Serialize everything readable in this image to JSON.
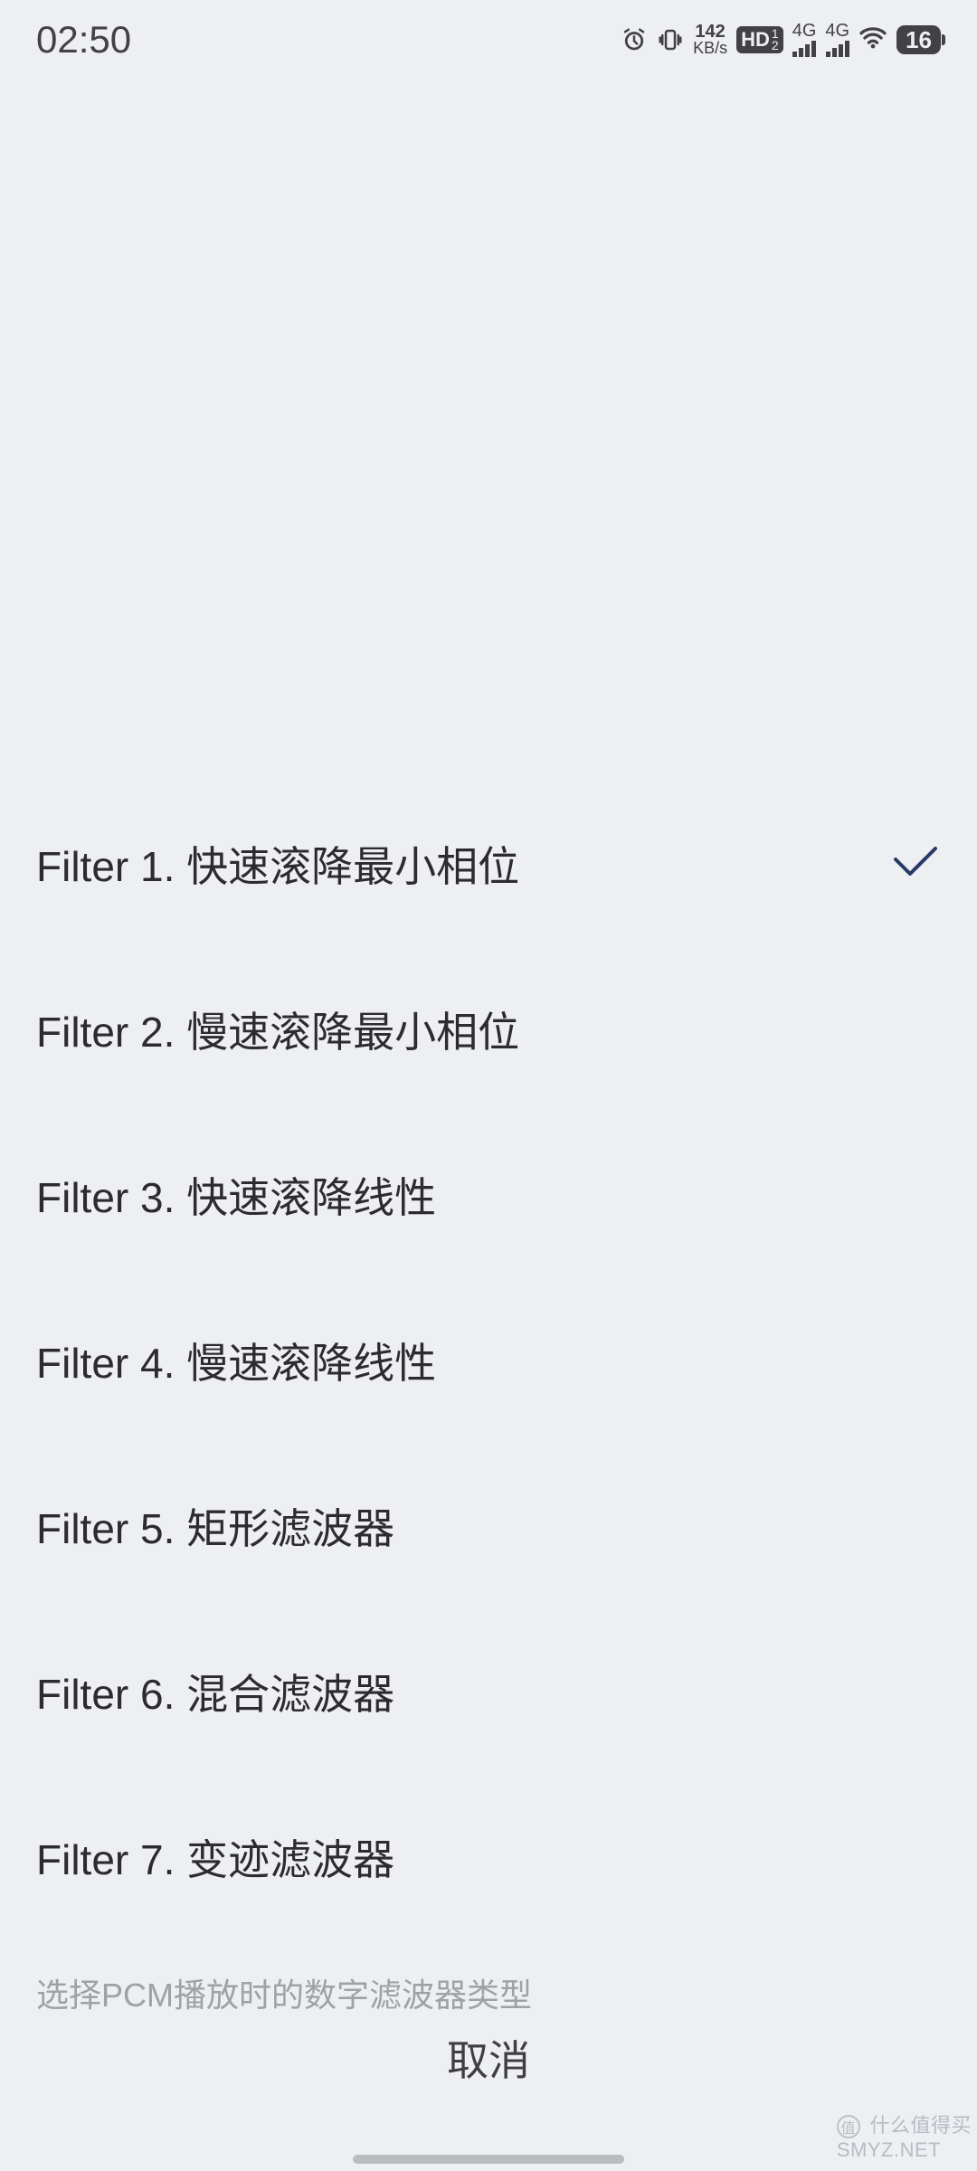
{
  "statusbar": {
    "time": "02:50",
    "net_speed_value": "142",
    "net_speed_unit": "KB/s",
    "hd_label": "HD",
    "sim1": "1",
    "sim2": "2",
    "signal1_label": "4G",
    "signal2_label": "4G",
    "battery_percent": "16"
  },
  "filters": [
    {
      "label": "Filter 1. 快速滚降最小相位",
      "selected": true
    },
    {
      "label": "Filter 2. 慢速滚降最小相位",
      "selected": false
    },
    {
      "label": "Filter 3. 快速滚降线性",
      "selected": false
    },
    {
      "label": "Filter 4. 慢速滚降线性",
      "selected": false
    },
    {
      "label": "Filter 5. 矩形滤波器",
      "selected": false
    },
    {
      "label": "Filter 6. 混合滤波器",
      "selected": false
    },
    {
      "label": "Filter 7. 变迹滤波器",
      "selected": false
    }
  ],
  "hint": "选择PCM播放时的数字滤波器类型",
  "cancel_label": "取消",
  "watermark": {
    "circle": "值",
    "text": "什么值得买",
    "site": "SMYZ.NET"
  },
  "colors": {
    "accent_check": "#273a65",
    "background": "#edeff3"
  }
}
